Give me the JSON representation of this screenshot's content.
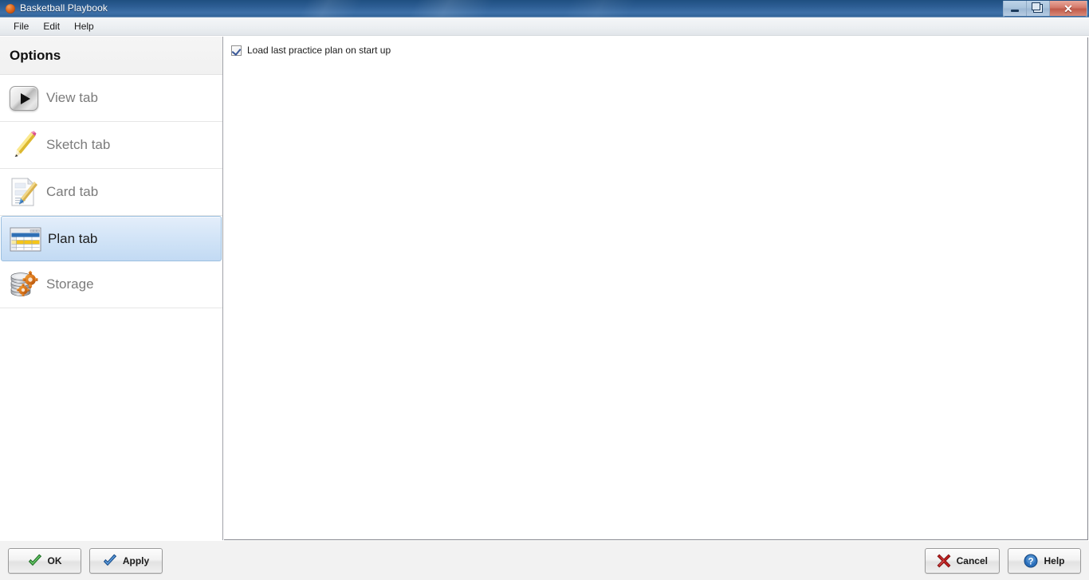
{
  "window": {
    "title": "Basketball Playbook",
    "app_icon": "basketball-icon",
    "controls": {
      "minimize": "minimize-button",
      "maximize": "maximize-button",
      "close_glyph": "✕"
    }
  },
  "menu": {
    "items": [
      {
        "label": "File"
      },
      {
        "label": "Edit"
      },
      {
        "label": "Help"
      }
    ]
  },
  "sidebar": {
    "header": "Options",
    "items": [
      {
        "label": "View tab",
        "icon": "play-button-icon",
        "selected": false
      },
      {
        "label": "Sketch tab",
        "icon": "pencil-icon",
        "selected": false
      },
      {
        "label": "Card tab",
        "icon": "document-pen-icon",
        "selected": false
      },
      {
        "label": "Plan tab",
        "icon": "table-window-icon",
        "selected": true
      },
      {
        "label": "Storage",
        "icon": "database-gear-icon",
        "selected": false
      }
    ]
  },
  "content": {
    "options": [
      {
        "label": "Load last practice plan on start up",
        "checked": true,
        "control": "checkbox"
      }
    ]
  },
  "footer": {
    "buttons_left": [
      {
        "label": "OK",
        "icon": "green-check-icon"
      },
      {
        "label": "Apply",
        "icon": "blue-check-icon"
      }
    ],
    "buttons_right": [
      {
        "label": "Cancel",
        "icon": "red-x-icon"
      },
      {
        "label": "Help",
        "icon": "blue-question-icon"
      }
    ]
  },
  "colors": {
    "titlebar_blue": "#2d5e94",
    "selection_blue": "#c2daf3",
    "selection_border": "#9cc0e0",
    "footer_gray": "#f2f2f2",
    "label_gray": "#7b7b7b",
    "accent_green": "#2f9e2f",
    "accent_blue": "#2a6ebb",
    "accent_red": "#c02020",
    "accent_orange": "#e06a1e"
  }
}
